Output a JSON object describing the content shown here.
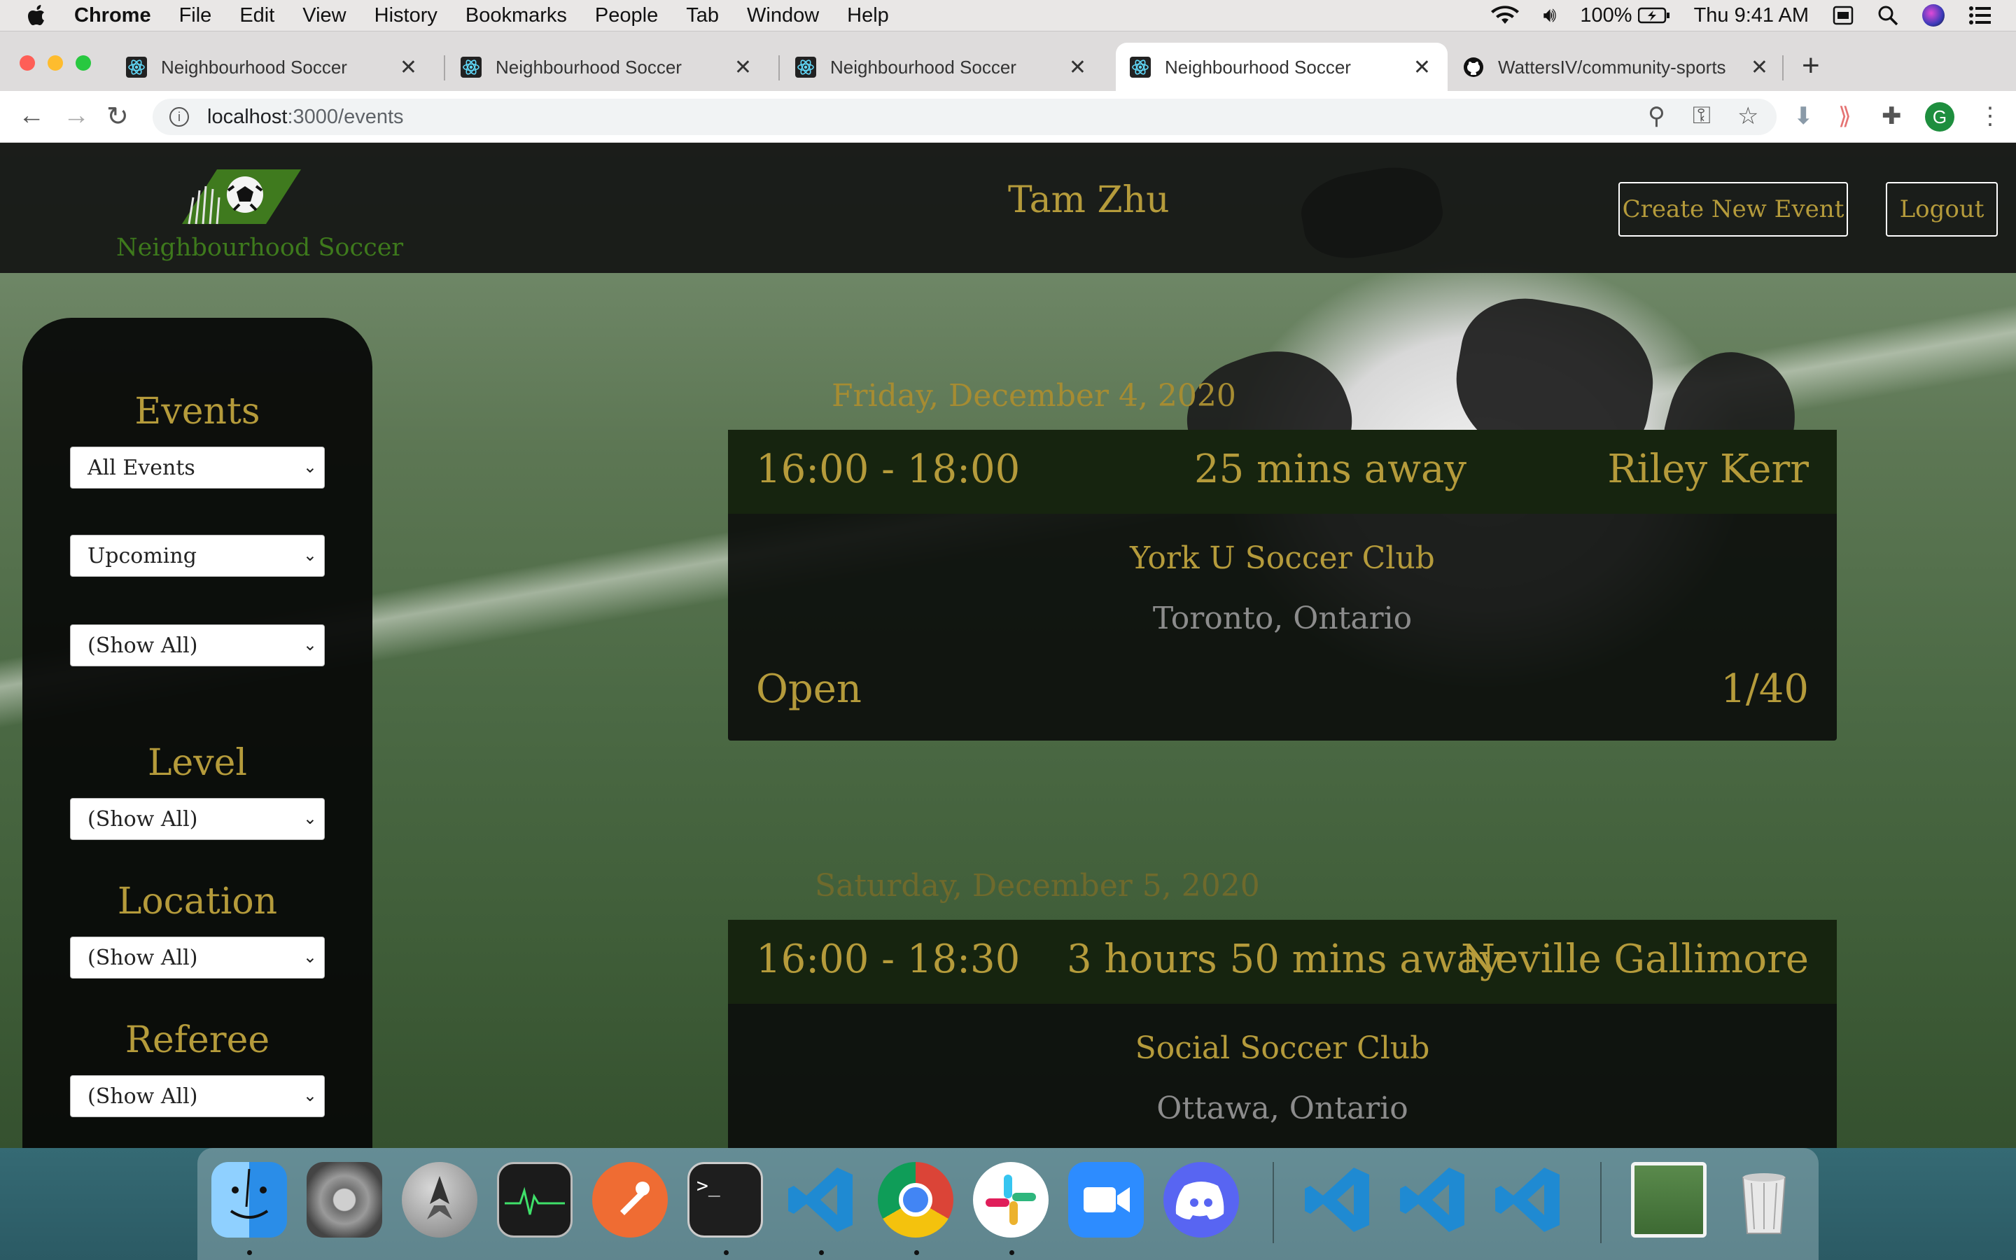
{
  "menubar": {
    "app": "Chrome",
    "items": [
      "File",
      "Edit",
      "View",
      "History",
      "Bookmarks",
      "People",
      "Tab",
      "Window",
      "Help"
    ],
    "battery": "100%",
    "clock": "Thu 9:41 AM",
    "icons": [
      "wifi-icon",
      "volume-icon",
      "battery-icon",
      "keyboard-icon",
      "search-icon",
      "siri-icon",
      "control-center-icon"
    ]
  },
  "tabs": [
    {
      "title": "Neighbourhood Soccer",
      "favicon": "react-icon",
      "active": false
    },
    {
      "title": "Neighbourhood Soccer",
      "favicon": "react-icon",
      "active": false
    },
    {
      "title": "Neighbourhood Soccer",
      "favicon": "react-icon",
      "active": false
    },
    {
      "title": "Neighbourhood Soccer",
      "favicon": "react-icon",
      "active": true
    },
    {
      "title": "WattersIV/community-sports",
      "favicon": "github-icon",
      "active": false
    }
  ],
  "address": {
    "host": "localhost",
    "path": ":3000/events"
  },
  "profile_initial": "G",
  "site": {
    "logo_text": "Neighbourhood Soccer",
    "user_name": "Tam Zhu",
    "create_button": "Create New Event",
    "logout_button": "Logout"
  },
  "sidebar": {
    "events_heading": "Events",
    "events_select": "All Events",
    "time_select": "Upcoming",
    "type_select": "(Show All)",
    "level_heading": "Level",
    "level_select": "(Show All)",
    "location_heading": "Location",
    "location_select": "(Show All)",
    "referee_heading": "Referee",
    "referee_select": "(Show All)"
  },
  "events": [
    {
      "date": "Friday, December 4, 2020",
      "time": "16:00 - 18:00",
      "away": "25 mins away",
      "referee": "Riley Kerr",
      "club": "York U Soccer Club",
      "city": "Toronto, Ontario",
      "status": "Open",
      "count": "1/40"
    },
    {
      "date": "Saturday, December 5, 2020",
      "time": "16:00 - 18:30",
      "away": "3 hours 50 mins away",
      "referee": "Neville Gallimore",
      "club": "Social Soccer Club",
      "city": "Ottawa, Ontario"
    }
  ],
  "colors": {
    "gold": "#b59b3b",
    "card_header": "#16240f",
    "navbar": "#121412"
  },
  "dock": [
    "finder-icon",
    "system-preferences-icon",
    "launchpad-icon",
    "activity-monitor-icon",
    "postman-icon",
    "terminal-icon",
    "vscode-icon",
    "chrome-icon",
    "slack-icon",
    "zoom-icon",
    "discord-icon",
    "vscode-icon",
    "vscode-icon",
    "vscode-icon",
    "photos-stack-icon",
    "trash-icon"
  ]
}
